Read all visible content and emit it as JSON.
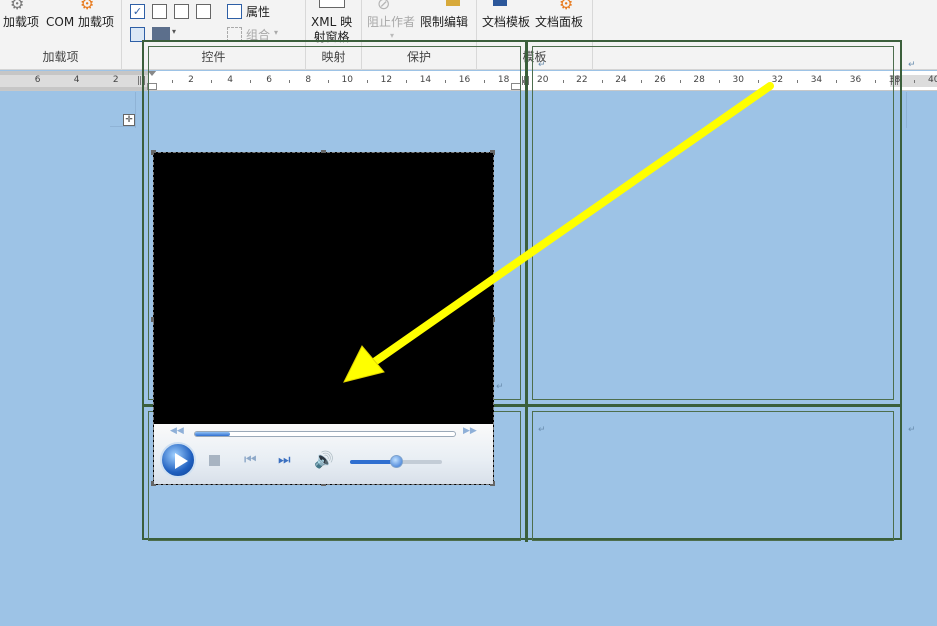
{
  "ribbon": {
    "addins": {
      "label": "加载项",
      "btn_addins": "加载项",
      "btn_com_line1": "COM",
      "btn_com_line2": "加载项"
    },
    "controls": {
      "label": "控件",
      "btn_properties": "属性",
      "btn_group": "组合"
    },
    "mapping": {
      "label": "映射",
      "btn_xml_line1": "XML 映",
      "btn_xml_line2": "射窗格"
    },
    "protect": {
      "label": "保护",
      "btn_block_authors": "阻止作者",
      "btn_restrict_editing": "限制编辑"
    },
    "templates": {
      "label": "模板",
      "btn_document_template": "文档模板",
      "btn_document_panel": "文档面板"
    }
  },
  "ruler": {
    "left_labels": [
      "6",
      "4",
      "2"
    ],
    "labels": [
      "2",
      "4",
      "6",
      "8",
      "10",
      "12",
      "14",
      "16",
      "18",
      "20",
      "22",
      "24",
      "26",
      "28",
      "30",
      "32",
      "34",
      "36",
      "38",
      "40"
    ]
  },
  "player": {
    "progress": 0.08,
    "volume": 0.5
  },
  "colors": {
    "page_bg": "#9dc3e6",
    "table_border": "#3b5f3b",
    "arrow": "#ffff00"
  }
}
